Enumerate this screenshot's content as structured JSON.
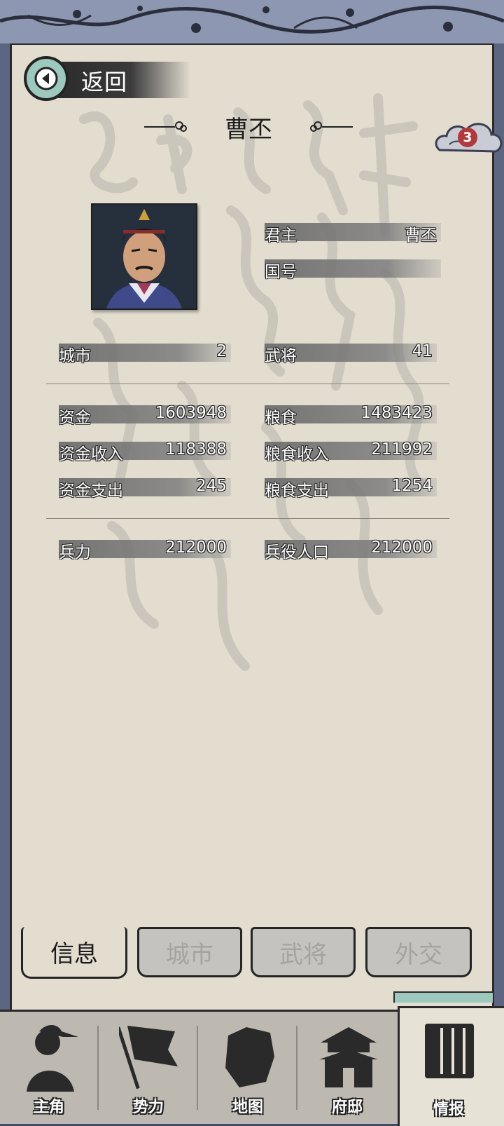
{
  "header": {
    "back_label": "返回",
    "title": "曹丕",
    "badge_count": "3"
  },
  "ruler": {
    "lord_label": "君主",
    "lord_value": "曹丕",
    "nation_label": "国号",
    "nation_value": ""
  },
  "stats": {
    "city_label": "城市",
    "city_value": "2",
    "general_label": "武将",
    "general_value": "41",
    "funds_label": "资金",
    "funds_value": "1603948",
    "grain_label": "粮食",
    "grain_value": "1483423",
    "funds_income_label": "资金收入",
    "funds_income_value": "118388",
    "grain_income_label": "粮食收入",
    "grain_income_value": "211992",
    "funds_expense_label": "资金支出",
    "funds_expense_value": "245",
    "grain_expense_label": "粮食支出",
    "grain_expense_value": "1254",
    "troops_label": "兵力",
    "troops_value": "212000",
    "conscript_label": "兵役人口",
    "conscript_value": "212000"
  },
  "subtabs": [
    {
      "label": "信息",
      "active": true
    },
    {
      "label": "城市",
      "active": false
    },
    {
      "label": "武将",
      "active": false
    },
    {
      "label": "外交",
      "active": false
    }
  ],
  "nav": [
    {
      "label": "主角",
      "icon": "warrior-icon"
    },
    {
      "label": "势力",
      "icon": "flag-icon"
    },
    {
      "label": "地图",
      "icon": "map-icon"
    },
    {
      "label": "府邸",
      "icon": "mansion-icon"
    },
    {
      "label": "情报",
      "icon": "scroll-icon",
      "active": true
    }
  ],
  "colors": {
    "paper": "#e3ddd0",
    "accent_green": "#9cc9bd",
    "badge_red": "#b3383c",
    "frame_blue": "#8e97b2"
  }
}
